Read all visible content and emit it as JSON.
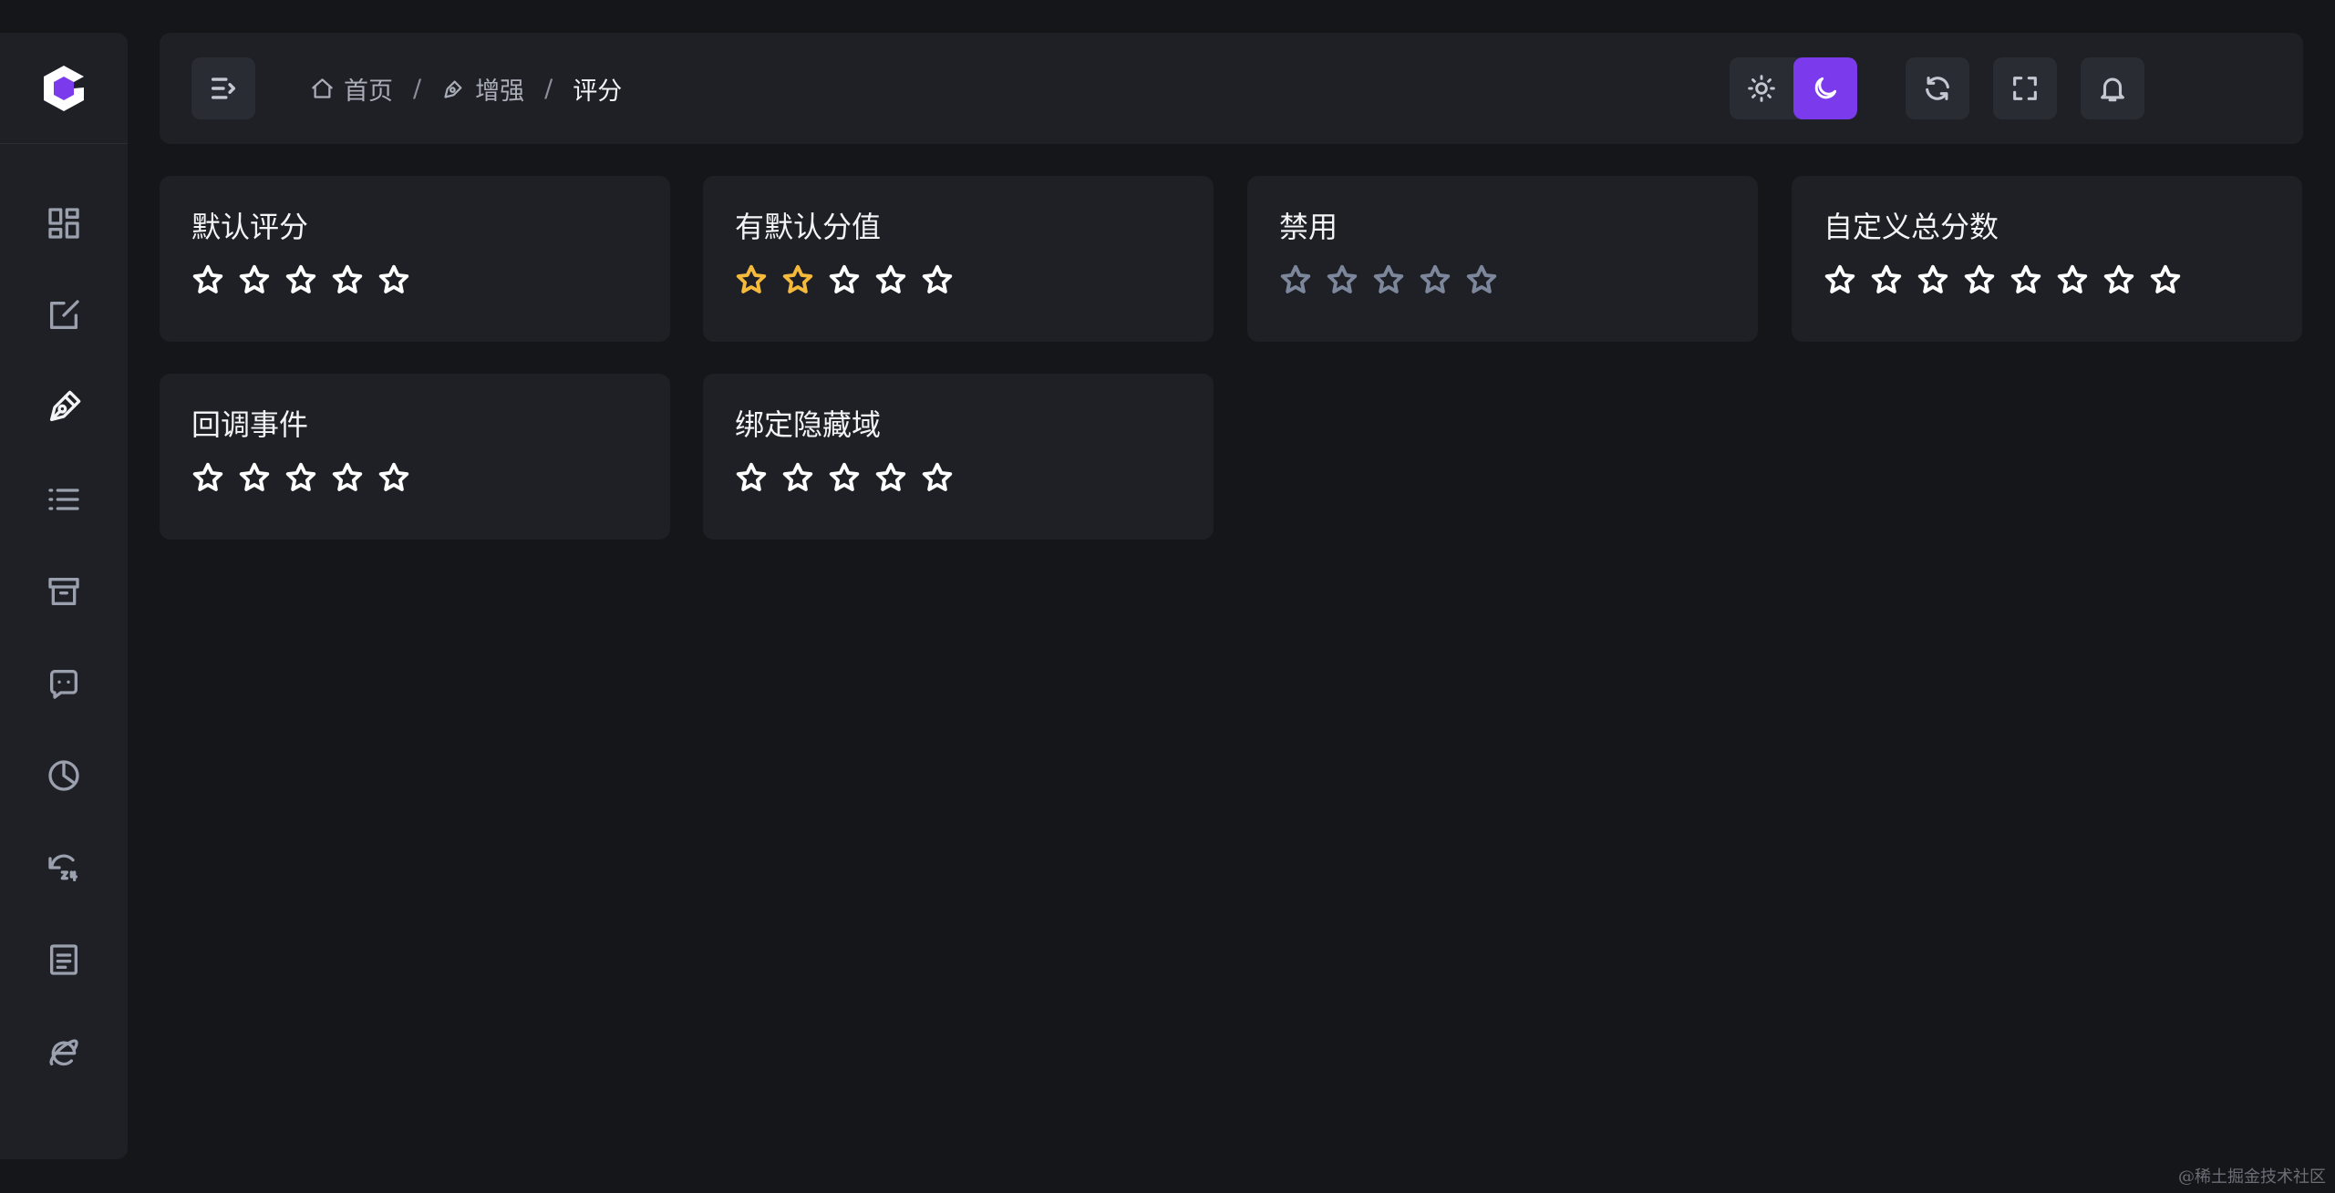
{
  "breadcrumb": {
    "home": "首页",
    "section": "增强",
    "separator": "/",
    "current": "评分"
  },
  "colors": {
    "accent": "#7c3aed",
    "star_active": "#f5b93b",
    "star_default": "#ffffff",
    "star_disabled": "#7d879c"
  },
  "sidebar": {
    "logo_icon": "app-logo-icon",
    "items": [
      {
        "icon": "dashboard-icon",
        "active": false
      },
      {
        "icon": "edit-icon",
        "active": false
      },
      {
        "icon": "pen-icon",
        "active": true
      },
      {
        "icon": "list-icon",
        "active": false
      },
      {
        "icon": "archive-icon",
        "active": false
      },
      {
        "icon": "chat-icon",
        "active": false
      },
      {
        "icon": "pie-chart-icon",
        "active": false
      },
      {
        "icon": "history-24-icon",
        "active": false
      },
      {
        "icon": "document-icon",
        "active": false
      },
      {
        "icon": "ie-browser-icon",
        "active": false
      }
    ]
  },
  "cards": [
    {
      "title": "默认评分",
      "total": 5,
      "value": 0,
      "disabled": false
    },
    {
      "title": "有默认分值",
      "total": 5,
      "value": 2,
      "disabled": false
    },
    {
      "title": "禁用",
      "total": 5,
      "value": 0,
      "disabled": true
    },
    {
      "title": "自定义总分数",
      "total": 8,
      "value": 0,
      "disabled": false
    },
    {
      "title": "回调事件",
      "total": 5,
      "value": 0,
      "disabled": false
    },
    {
      "title": "绑定隐藏域",
      "total": 5,
      "value": 0,
      "disabled": false
    }
  ],
  "theme": {
    "mode": "dark"
  },
  "watermark": "@稀土掘金技术社区"
}
